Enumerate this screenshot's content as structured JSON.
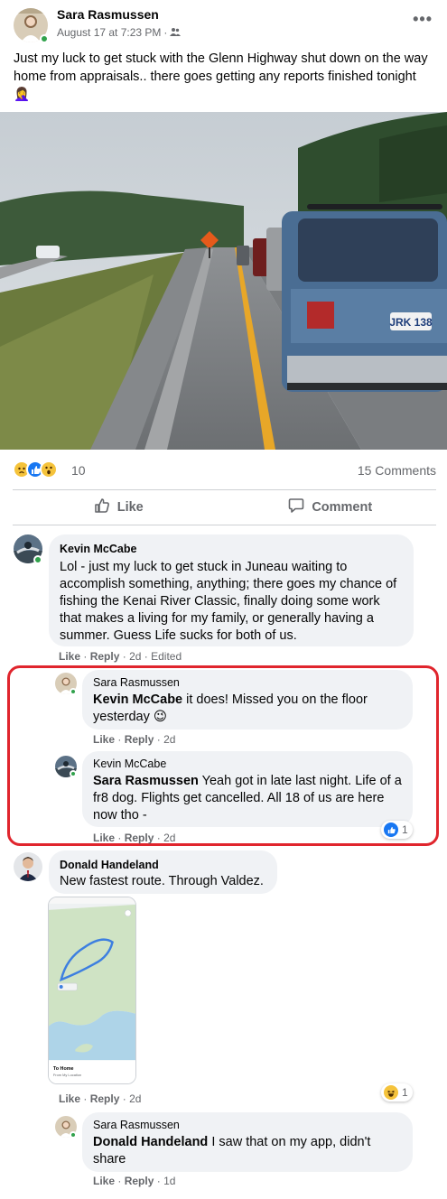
{
  "post": {
    "author": "Sara Rasmussen",
    "timestamp": "August 17 at 7:23 PM",
    "meta_separator": "·",
    "text": "Just my luck to get stuck with the Glenn Highway shut down on the way home from appraisals.. there goes getting any reports finished tonight 🤦‍♀️",
    "plate_text": "JRK 138",
    "reaction_count": "10",
    "comment_count": "15 Comments",
    "reaction_icons": [
      "sad-icon",
      "like-icon",
      "wow-icon"
    ],
    "more_icon": "more-horizontal-icon",
    "audience_icon": "friends-icon"
  },
  "actions": {
    "like_label": "Like",
    "comment_label": "Comment",
    "like_icon": "thumbs-up-icon",
    "comment_icon": "speech-bubble-icon"
  },
  "comments": [
    {
      "author": "Kevin McCabe",
      "text": "Lol - just my luck to get stuck in Juneau waiting to accomplish something, anything; there goes my chance of fishing the Kenai River Classic, finally doing some work that makes a living for my family, or generally having a summer. Guess Life sucks for both of us.",
      "like": "Like",
      "reply": "Reply",
      "time": "2d",
      "edited": "Edited",
      "replies": [
        {
          "author": "Sara Rasmussen",
          "tag": "Kevin McCabe",
          "text": " it does! Missed you on the floor yesterday 😉",
          "like": "Like",
          "reply": "Reply",
          "time": "2d"
        },
        {
          "author": "Kevin McCabe",
          "tag": "Sara Rasmussen",
          "text": " Yeah got in late last night. Life of a fr8 dog. Flights get cancelled. All 18 of us are here now tho -",
          "like": "Like",
          "reply": "Reply",
          "time": "2d",
          "reaction_count": "1"
        }
      ]
    },
    {
      "author": "Donald Handeland",
      "text": "New fastest route. Through Valdez.",
      "like": "Like",
      "reply": "Reply",
      "time": "2d",
      "reaction_count": "1",
      "map_destination": "To Home",
      "map_origin": "From My Location",
      "replies": [
        {
          "author": "Sara Rasmussen",
          "tag": "Donald Handeland",
          "text": " I saw that on my app, didn't share",
          "like": "Like",
          "reply": "Reply",
          "time": "1d"
        }
      ]
    }
  ],
  "colors": {
    "accent": "#1877f2",
    "highlight": "#e0252d",
    "online": "#31a24c",
    "secondary_text": "#65676b",
    "bubble": "#f0f2f5"
  }
}
